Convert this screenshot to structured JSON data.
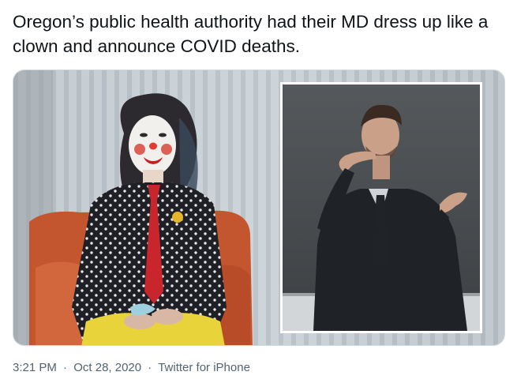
{
  "tweet": {
    "text": "Oregon’s public health authority had their MD dress up like a clown and announce COVID deaths."
  },
  "media": {
    "image_kind": "photo"
  },
  "meta": {
    "time": "3:21 PM",
    "separator": "·",
    "date": "Oct 28, 2020",
    "source": "Twitter for iPhone"
  }
}
